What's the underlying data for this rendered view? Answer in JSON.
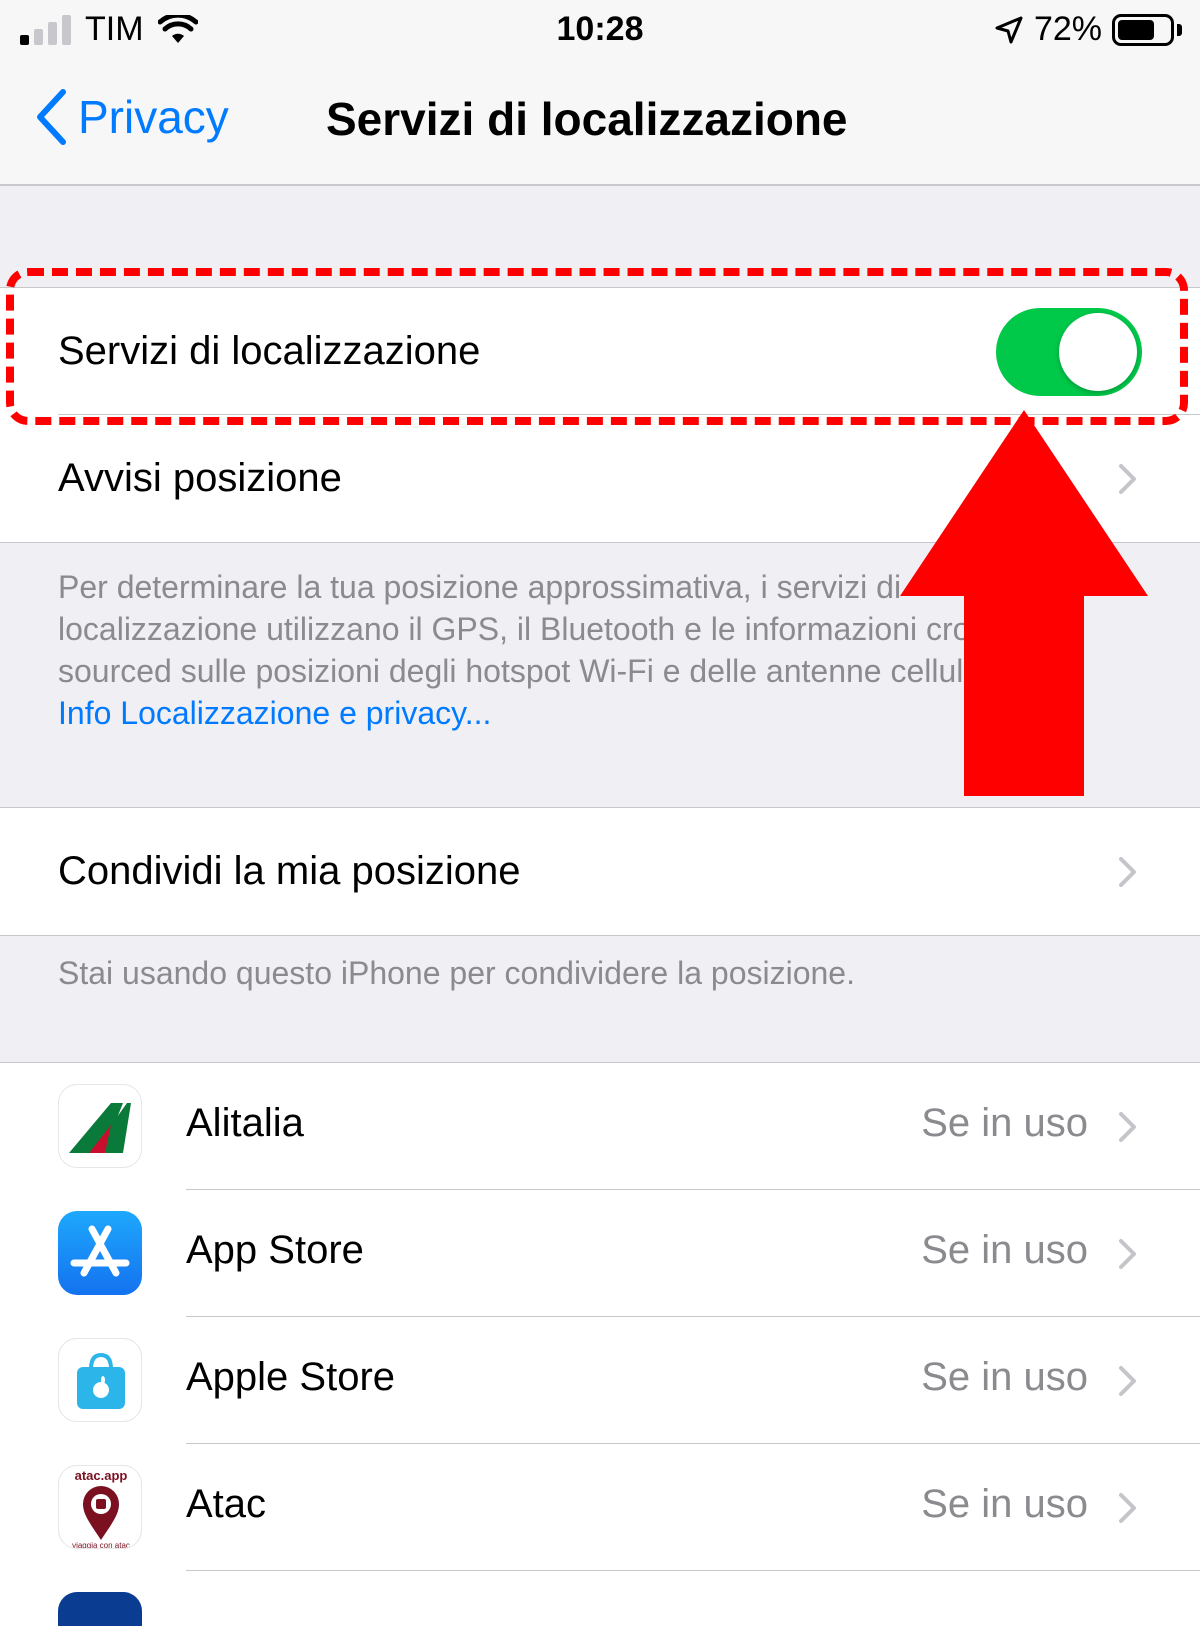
{
  "status_bar": {
    "carrier": "TIM",
    "time": "10:28",
    "battery_percent": "72%",
    "battery_level": 0.72,
    "icons": [
      "signal-icon",
      "wifi-icon",
      "location-arrow-icon",
      "battery-icon"
    ]
  },
  "nav": {
    "back_label": "Privacy",
    "title": "Servizi di localizzazione"
  },
  "main_group": {
    "location_services_label": "Servizi di localizzazione",
    "location_services_on": true,
    "location_alerts_label": "Avvisi posizione"
  },
  "description": {
    "text": "Per determinare la tua posizione approssimativa, i servizi di localizzazione utilizzano il GPS, il Bluetooth e le informazioni crowd-sourced sulle posizioni degli hotspot Wi-Fi e delle antenne cellulari. ",
    "link": "Info Localizzazione e privacy..."
  },
  "share_group": {
    "share_label": "Condividi la mia posizione",
    "footer": "Stai usando questo iPhone per condividere la posizione."
  },
  "apps": [
    {
      "name": "Alitalia",
      "value": "Se in uso",
      "icon": "alitalia-icon"
    },
    {
      "name": "App Store",
      "value": "Se in uso",
      "icon": "app-store-icon"
    },
    {
      "name": "Apple Store",
      "value": "Se in uso",
      "icon": "apple-store-icon"
    },
    {
      "name": "Atac",
      "value": "Se in uso",
      "icon": "atac-icon",
      "icon_text_top": "atac.app",
      "icon_text_bottom": "viaggia con atac"
    }
  ],
  "colors": {
    "accent": "#007aff",
    "toggle_on": "#00c94a",
    "annotation": "#ff0000",
    "background": "#efeff4"
  }
}
